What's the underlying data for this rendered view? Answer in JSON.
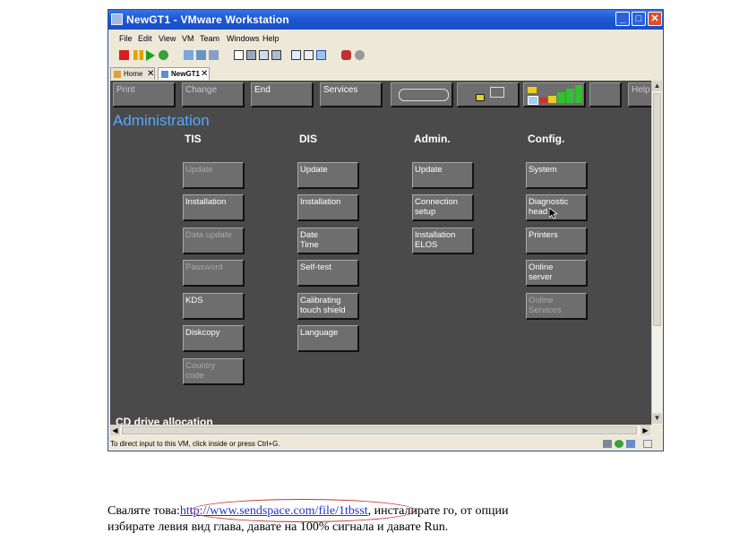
{
  "window": {
    "title": "NewGT1 - VMware Workstation",
    "controls": {
      "minimize": "_",
      "maximize": "□",
      "close": "✕"
    }
  },
  "menu": [
    "File",
    "Edit",
    "View",
    "VM",
    "Team",
    "Windows",
    "Help"
  ],
  "tabs": [
    {
      "label": "Home",
      "close": "✕"
    },
    {
      "label": "NewGT1",
      "close": "✕"
    }
  ],
  "vm": {
    "top_buttons": [
      {
        "label": "Print",
        "enabled": false
      },
      {
        "label": "Change",
        "enabled": false
      },
      {
        "label": "End",
        "enabled": true
      },
      {
        "label": "Services",
        "enabled": true
      },
      {
        "label": "Help",
        "enabled": false
      }
    ],
    "heading": "Administration",
    "columns": [
      {
        "title": "TIS",
        "buttons": [
          {
            "label": "Update",
            "enabled": false
          },
          {
            "label": "Installation",
            "enabled": true
          },
          {
            "label": "Data update",
            "enabled": false
          },
          {
            "label": "Password",
            "enabled": false
          },
          {
            "label": "KDS",
            "enabled": true
          },
          {
            "label": "Diskcopy",
            "enabled": true
          },
          {
            "label": "Country\ncode",
            "enabled": false
          }
        ]
      },
      {
        "title": "DIS",
        "buttons": [
          {
            "label": "Update",
            "enabled": true
          },
          {
            "label": "Installation",
            "enabled": true
          },
          {
            "label": "Date\nTime",
            "enabled": true
          },
          {
            "label": "Self-test",
            "enabled": true
          },
          {
            "label": "Calibrating\ntouch shield",
            "enabled": true
          },
          {
            "label": "Language",
            "enabled": true
          }
        ]
      },
      {
        "title": "Admin.",
        "buttons": [
          {
            "label": "Update",
            "enabled": true
          },
          {
            "label": "Connection\nsetup",
            "enabled": true
          },
          {
            "label": "Installation\nELOS",
            "enabled": true
          }
        ]
      },
      {
        "title": "Config.",
        "buttons": [
          {
            "label": "System",
            "enabled": true
          },
          {
            "label": "Diagnostic head",
            "enabled": true
          },
          {
            "label": "Printers",
            "enabled": true
          },
          {
            "label": "Online\nserver",
            "enabled": true
          },
          {
            "label": "Online\nServices",
            "enabled": false
          }
        ]
      }
    ],
    "section_cutoff": "CD drive allocation"
  },
  "status": {
    "text": "To direct input to this VM, click inside or press Ctrl+G."
  },
  "document": {
    "line1_before": "Сваляте това:",
    "link": "http://www.sendspace.com/file/1tbsst",
    "line1_after": ", инсталирате го, от опции",
    "line2": "избирате левия вид глава, давате на 100% сигнала и давате Run."
  },
  "colors": {
    "vm_bg": "#4a4a4a",
    "heading": "#55a8ff",
    "titlebar": "#1e57d4"
  },
  "icons": [
    "vmware-app-icon",
    "home-icon",
    "vm-tab-icon",
    "mouse-cursor-icon"
  ]
}
